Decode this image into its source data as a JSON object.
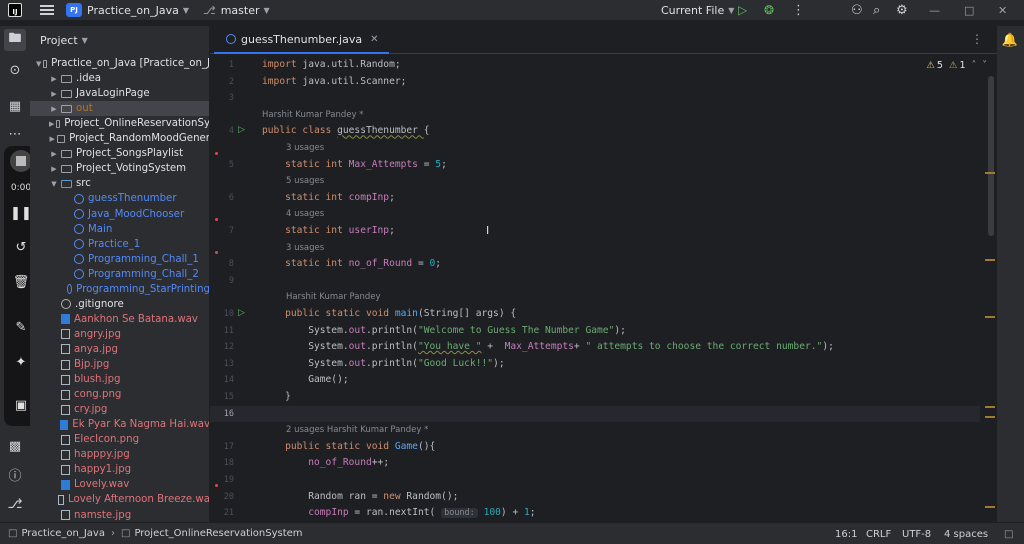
{
  "titlebar": {
    "logo": "IJ",
    "project_badge": "PJ",
    "project_name": "Practice_on_Java",
    "branch": "master",
    "run_config": "Current File"
  },
  "recorder": {
    "time": "0:00"
  },
  "project_panel": {
    "title": "Project",
    "tree": [
      {
        "label": "Practice_on_Java [Practice_on_J",
        "kind": "folder",
        "indent": 0,
        "arrow": "down"
      },
      {
        "label": ".idea",
        "kind": "folder",
        "indent": 1,
        "arrow": "right"
      },
      {
        "label": "JavaLoginPage",
        "kind": "folder",
        "indent": 1,
        "arrow": "right"
      },
      {
        "label": "out",
        "kind": "out",
        "indent": 1,
        "arrow": "right"
      },
      {
        "label": "Project_OnlineReservationSy",
        "kind": "folder",
        "indent": 1,
        "arrow": "right"
      },
      {
        "label": "Project_RandomMoodGener",
        "kind": "folder",
        "indent": 1,
        "arrow": "right"
      },
      {
        "label": "Project_SongsPlaylist",
        "kind": "folder",
        "indent": 1,
        "arrow": "right"
      },
      {
        "label": "Project_VotingSystem",
        "kind": "folder",
        "indent": 1,
        "arrow": "right"
      },
      {
        "label": "src",
        "kind": "src",
        "indent": 1,
        "arrow": "down"
      },
      {
        "label": "guessThenumber",
        "kind": "java",
        "indent": 2,
        "arrow": ""
      },
      {
        "label": "Java_MoodChooser",
        "kind": "java",
        "indent": 2,
        "arrow": ""
      },
      {
        "label": "Main",
        "kind": "java",
        "indent": 2,
        "arrow": ""
      },
      {
        "label": "Practice_1",
        "kind": "java",
        "indent": 2,
        "arrow": ""
      },
      {
        "label": "Programming_Chall_1",
        "kind": "java",
        "indent": 2,
        "arrow": ""
      },
      {
        "label": "Programming_Chall_2",
        "kind": "java",
        "indent": 2,
        "arrow": ""
      },
      {
        "label": "Programming_StarPrinting",
        "kind": "java",
        "indent": 2,
        "arrow": ""
      },
      {
        "label": ".gitignore",
        "kind": "git",
        "indent": 1,
        "arrow": ""
      },
      {
        "label": "Aankhon Se Batana.wav",
        "kind": "media",
        "indent": 1,
        "arrow": ""
      },
      {
        "label": "angry.jpg",
        "kind": "media",
        "indent": 1,
        "arrow": ""
      },
      {
        "label": "anya.jpg",
        "kind": "media",
        "indent": 1,
        "arrow": ""
      },
      {
        "label": "Bjp.jpg",
        "kind": "media",
        "indent": 1,
        "arrow": ""
      },
      {
        "label": "blush.jpg",
        "kind": "media",
        "indent": 1,
        "arrow": ""
      },
      {
        "label": "cong.png",
        "kind": "media",
        "indent": 1,
        "arrow": ""
      },
      {
        "label": "cry.jpg",
        "kind": "media",
        "indent": 1,
        "arrow": ""
      },
      {
        "label": "Ek Pyar Ka Nagma Hai.wav",
        "kind": "media",
        "indent": 1,
        "arrow": ""
      },
      {
        "label": "ElecIcon.png",
        "kind": "media",
        "indent": 1,
        "arrow": ""
      },
      {
        "label": "happpy.jpg",
        "kind": "media",
        "indent": 1,
        "arrow": ""
      },
      {
        "label": "happy1.jpg",
        "kind": "media",
        "indent": 1,
        "arrow": ""
      },
      {
        "label": "Lovely.wav",
        "kind": "media",
        "indent": 1,
        "arrow": ""
      },
      {
        "label": "Lovely Afternoon Breeze.wa",
        "kind": "media",
        "indent": 1,
        "arrow": ""
      },
      {
        "label": "namste.jpg",
        "kind": "media",
        "indent": 1,
        "arrow": ""
      }
    ]
  },
  "editor": {
    "tab": "guessThenumber.java",
    "warnings": "5",
    "weak_warnings": "1",
    "lines": [
      {
        "n": "1",
        "tokens": [
          [
            "kw",
            "import "
          ],
          [
            "cls",
            "java.util.Random;"
          ]
        ]
      },
      {
        "n": "2",
        "tokens": [
          [
            "kw",
            "import "
          ],
          [
            "cls",
            "java.util.Scanner;"
          ]
        ]
      },
      {
        "n": "3",
        "tokens": []
      },
      {
        "hint": "Harshit Kumar Pandey *",
        "indent": 0
      },
      {
        "n": "4",
        "run": true,
        "tokens": [
          [
            "kw",
            "public class "
          ],
          [
            "cls",
            "guessThenumber "
          ],
          [
            "cls",
            "{"
          ]
        ]
      },
      {
        "hint": "3 usages",
        "indent": 1
      },
      {
        "n": "5",
        "dot": true,
        "tokens": [
          [
            "kw",
            "    static int "
          ],
          [
            "fld",
            "Max_Attempts"
          ],
          [
            "cls",
            " = "
          ],
          [
            "num",
            "5"
          ],
          [
            "cls",
            ";"
          ]
        ]
      },
      {
        "hint": "5 usages",
        "indent": 1
      },
      {
        "n": "6",
        "tokens": [
          [
            "kw",
            "    static int "
          ],
          [
            "fld",
            "compInp"
          ],
          [
            "cls",
            ";"
          ]
        ]
      },
      {
        "hint": "4 usages",
        "indent": 1
      },
      {
        "n": "7",
        "dot": true,
        "tokens": [
          [
            "kw",
            "    static int "
          ],
          [
            "fld",
            "userInp"
          ],
          [
            "cls",
            ";"
          ]
        ]
      },
      {
        "hint": "3 usages",
        "indent": 1
      },
      {
        "n": "8",
        "dot": true,
        "tokens": [
          [
            "kw",
            "    static int "
          ],
          [
            "fld",
            "no_of_Round"
          ],
          [
            "cls",
            " = "
          ],
          [
            "num",
            "0"
          ],
          [
            "cls",
            ";"
          ]
        ]
      },
      {
        "n": "9",
        "tokens": []
      },
      {
        "hint": "Harshit Kumar Pandey",
        "indent": 1
      },
      {
        "n": "10",
        "run": true,
        "tokens": [
          [
            "kw",
            "    public static void "
          ],
          [
            "fn",
            "main"
          ],
          [
            "cls",
            "(String[] args) {"
          ]
        ]
      },
      {
        "n": "11",
        "tokens": [
          [
            "cls",
            "        System."
          ],
          [
            "fld",
            "out"
          ],
          [
            "cls",
            ".println("
          ],
          [
            "str",
            "\"Welcome to Guess The Number Game\""
          ],
          [
            "cls",
            ");"
          ]
        ]
      },
      {
        "n": "12",
        "tokens": [
          [
            "cls",
            "        System."
          ],
          [
            "fld",
            "out"
          ],
          [
            "cls",
            ".println("
          ],
          [
            "str",
            "\"You have \""
          ],
          [
            "cls",
            " +  "
          ],
          [
            "fld",
            "Max_Attempts"
          ],
          [
            "cls",
            "+ "
          ],
          [
            "str",
            "\" attempts to choose the correct number.\""
          ],
          [
            "cls",
            ");"
          ]
        ]
      },
      {
        "n": "13",
        "tokens": [
          [
            "cls",
            "        System."
          ],
          [
            "fld",
            "out"
          ],
          [
            "cls",
            ".println("
          ],
          [
            "str",
            "\"Good Luck!!\""
          ],
          [
            "cls",
            ");"
          ]
        ]
      },
      {
        "n": "14",
        "tokens": [
          [
            "cls",
            "        Game();"
          ]
        ]
      },
      {
        "n": "15",
        "tokens": [
          [
            "cls",
            "    }"
          ]
        ]
      },
      {
        "n": "16",
        "current": true,
        "tokens": []
      },
      {
        "hint": "2 usages   Harshit Kumar Pandey *",
        "indent": 1
      },
      {
        "n": "17",
        "tokens": [
          [
            "kw",
            "    public static void "
          ],
          [
            "fn",
            "Game"
          ],
          [
            "cls",
            "(){"
          ]
        ]
      },
      {
        "n": "18",
        "tokens": [
          [
            "cls",
            "        "
          ],
          [
            "fld",
            "no_of_Round"
          ],
          [
            "cls",
            "++;"
          ]
        ]
      },
      {
        "n": "19",
        "tokens": []
      },
      {
        "n": "20",
        "dot": true,
        "tokens": [
          [
            "cls",
            "        Random ran = "
          ],
          [
            "kw",
            "new "
          ],
          [
            "cls",
            "Random();"
          ]
        ]
      },
      {
        "n": "21",
        "tokens": [
          [
            "cls",
            "        "
          ],
          [
            "fld",
            "compInp"
          ],
          [
            "cls",
            " = ran.nextInt( "
          ],
          [
            "hintp",
            "bound:"
          ],
          [
            "num",
            " 100"
          ],
          [
            "cls",
            ") + "
          ],
          [
            "num",
            "1"
          ],
          [
            "cls",
            ";"
          ]
        ]
      }
    ]
  },
  "statusbar": {
    "breadcrumb_1": "Practice_on_Java",
    "breadcrumb_2": "Project_OnlineReservationSystem",
    "position": "16:1",
    "line_sep": "CRLF",
    "encoding": "UTF-8",
    "indent": "4 spaces"
  }
}
